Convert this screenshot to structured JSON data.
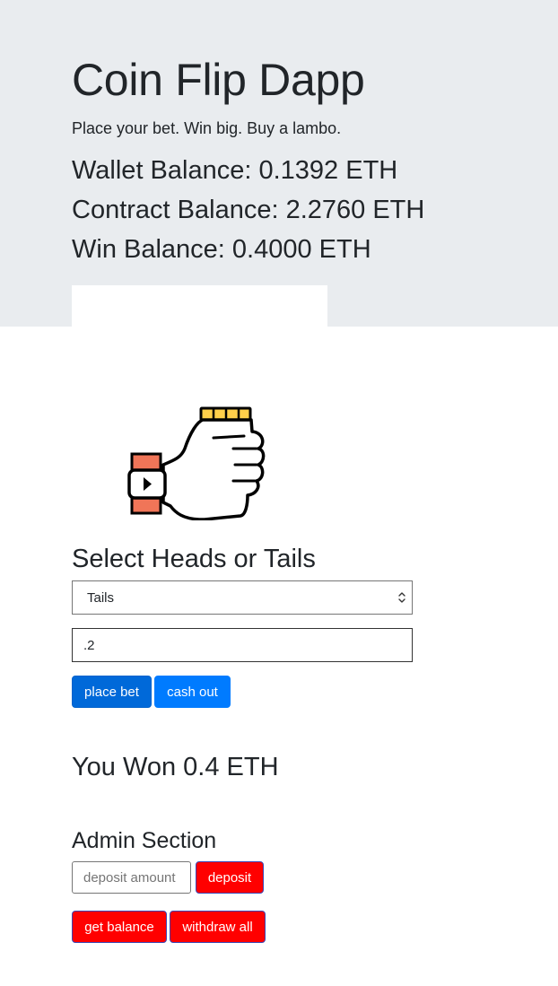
{
  "header": {
    "title": "Coin Flip Dapp",
    "tagline": "Place your bet. Win big. Buy a lambo.",
    "balances": [
      "Wallet Balance: 0.1392 ETH",
      "Contract Balance: 2.2760 ETH",
      "Win Balance: 0.4000 ETH"
    ]
  },
  "illustration": {
    "icon": "hand-flipping-coin-icon"
  },
  "bet": {
    "heading": "Select Heads or Tails",
    "selected_option": "Tails",
    "amount_value": ".2",
    "place_bet_label": "place bet",
    "cash_out_label": "cash out"
  },
  "result": {
    "text": "You Won 0.4 ETH"
  },
  "admin": {
    "heading": "Admin Section",
    "deposit_placeholder": "deposit amount",
    "deposit_label": "deposit",
    "get_balance_label": "get balance",
    "withdraw_all_label": "withdraw all"
  },
  "colors": {
    "jumbotron_background": "#e9ecef",
    "primary_button": "#007bff",
    "primary_button_active": "#0069d9",
    "admin_button": "#ff0000",
    "text": "#212529"
  }
}
